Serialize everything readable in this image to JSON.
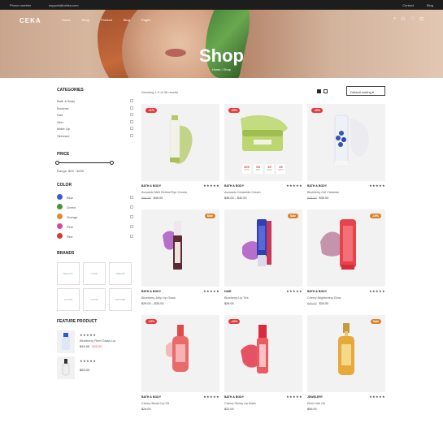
{
  "topbar": {
    "phone": "Phone number",
    "email": "support@cekka.com",
    "right1": "Contact",
    "right2": "Blog"
  },
  "header": {
    "logo": "CEKA",
    "nav": [
      "Home",
      "Shop",
      "Product",
      "Blog",
      "Pages"
    ],
    "title": "Shop",
    "breadcrumb": "Home  /  Shop",
    "cart_count": "0"
  },
  "sidebar": {
    "categories_title": "CATEGORIES",
    "categories": [
      "Bath & Body",
      "Brushes",
      "Hair",
      "Skin",
      "Make Up",
      "Skincare"
    ],
    "price_title": "PRICE",
    "price_range": "Range: $29 - $200",
    "color_title": "COLOR",
    "colors": [
      {
        "label": "Blue",
        "hex": "#3b5bcb"
      },
      {
        "label": "Green",
        "hex": "#3f9a3a"
      },
      {
        "label": "Orange",
        "hex": "#e58a2b"
      },
      {
        "label": "Pink",
        "hex": "#d6489c"
      },
      {
        "label": "Red",
        "hex": "#d63a35"
      }
    ],
    "brands_title": "BRANDS",
    "brands": [
      "BEAUTY",
      "LUXE",
      "SERUM",
      "LOTUS",
      "GLOW",
      "NATURE"
    ],
    "featured_title": "FEATURE PRODUCT",
    "featured": [
      {
        "stars": "★★★★★",
        "name": "Blueberry Reef Glass Lip",
        "price": "$19.00",
        "old": "$25.00"
      },
      {
        "stars": "★★★★★",
        "name": "Mini Serum",
        "price": "$59.00",
        "old": ""
      }
    ]
  },
  "toolbar": {
    "results": "Showing 1-9 of 36 results",
    "sort": "Default sorting"
  },
  "products": [
    {
      "badge": "-11%",
      "brand": "BATH & BODY",
      "stars": "★★★★★",
      "name": "Avocado Melt Retinol Eye Cream",
      "price": "$45.00",
      "old": "$55.00"
    },
    {
      "badge": "-20%",
      "brand": "BATH & BODY",
      "stars": "★★★★★",
      "name": "Avocado Ceramide Cream",
      "price": "$36.00 – $42.00",
      "old": "",
      "timer": [
        {
          "v": "459",
          "u": "DAYS"
        },
        {
          "v": "08",
          "u": "HRS"
        },
        {
          "v": "40",
          "u": "MINS"
        },
        {
          "v": "26",
          "u": "SECS"
        }
      ]
    },
    {
      "badge": "-10%",
      "brand": "BATH & BODY",
      "stars": "★★★★★",
      "name": "Blueberry Gel Cleanser",
      "price": "$30.00",
      "old": "$38.00"
    },
    {
      "badge": "Sale",
      "brand": "BATH & BODY",
      "stars": "★★★★★",
      "name": "Blueberry Jelly Lip Gloss",
      "price": "$29.00 – $33.00",
      "old": ""
    },
    {
      "badge": "Sale",
      "brand": "HAIR",
      "stars": "★★★★★",
      "name": "Blueberry Lip Tint",
      "price": "$28.00",
      "old": ""
    },
    {
      "badge": "-15%",
      "brand": "BATH & BODY",
      "stars": "★★★★★",
      "name": "Cherry Brightening Glow",
      "price": "$34.00",
      "old": "$40.00"
    },
    {
      "badge": "-12%",
      "brand": "BATH & BODY",
      "stars": "★★★★★",
      "name": "Cherry Bomb Lip Oil",
      "price": "$24.00",
      "old": ""
    },
    {
      "badge": "-10%",
      "brand": "BATH & BODY",
      "stars": "★★★★★",
      "name": "Cherry Glowy Lip Balm",
      "price": "$22.00",
      "old": ""
    },
    {
      "badge": "Sale",
      "brand": "JEWELERY",
      "stars": "★★★★★",
      "name": "Elixir Hair Oil",
      "price": "$59.00",
      "old": ""
    }
  ],
  "colors": {
    "accent": "#e23b3b",
    "sale": "#d9822b",
    "dark": "#1d1d1d"
  }
}
